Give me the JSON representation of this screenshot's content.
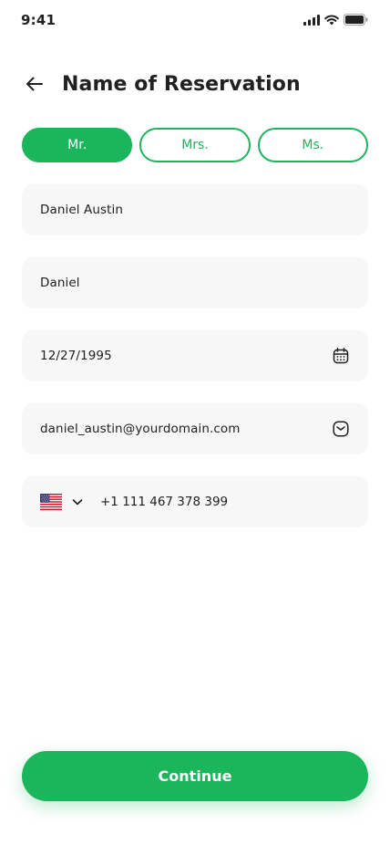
{
  "status_bar": {
    "time": "9:41"
  },
  "header": {
    "title": "Name of Reservation"
  },
  "title_options": [
    {
      "label": "Mr.",
      "selected": true
    },
    {
      "label": "Mrs.",
      "selected": false
    },
    {
      "label": "Ms.",
      "selected": false
    }
  ],
  "form": {
    "full_name": "Daniel Austin",
    "nickname": "Daniel",
    "date_of_birth": "12/27/1995",
    "email": "daniel_austin@yourdomain.com",
    "phone": "+1 111 467 378 399",
    "country_flag": "us-flag"
  },
  "actions": {
    "continue_label": "Continue"
  },
  "colors": {
    "accent": "#1BB55C",
    "field_bg": "#F7F7F7",
    "text": "#212121"
  }
}
